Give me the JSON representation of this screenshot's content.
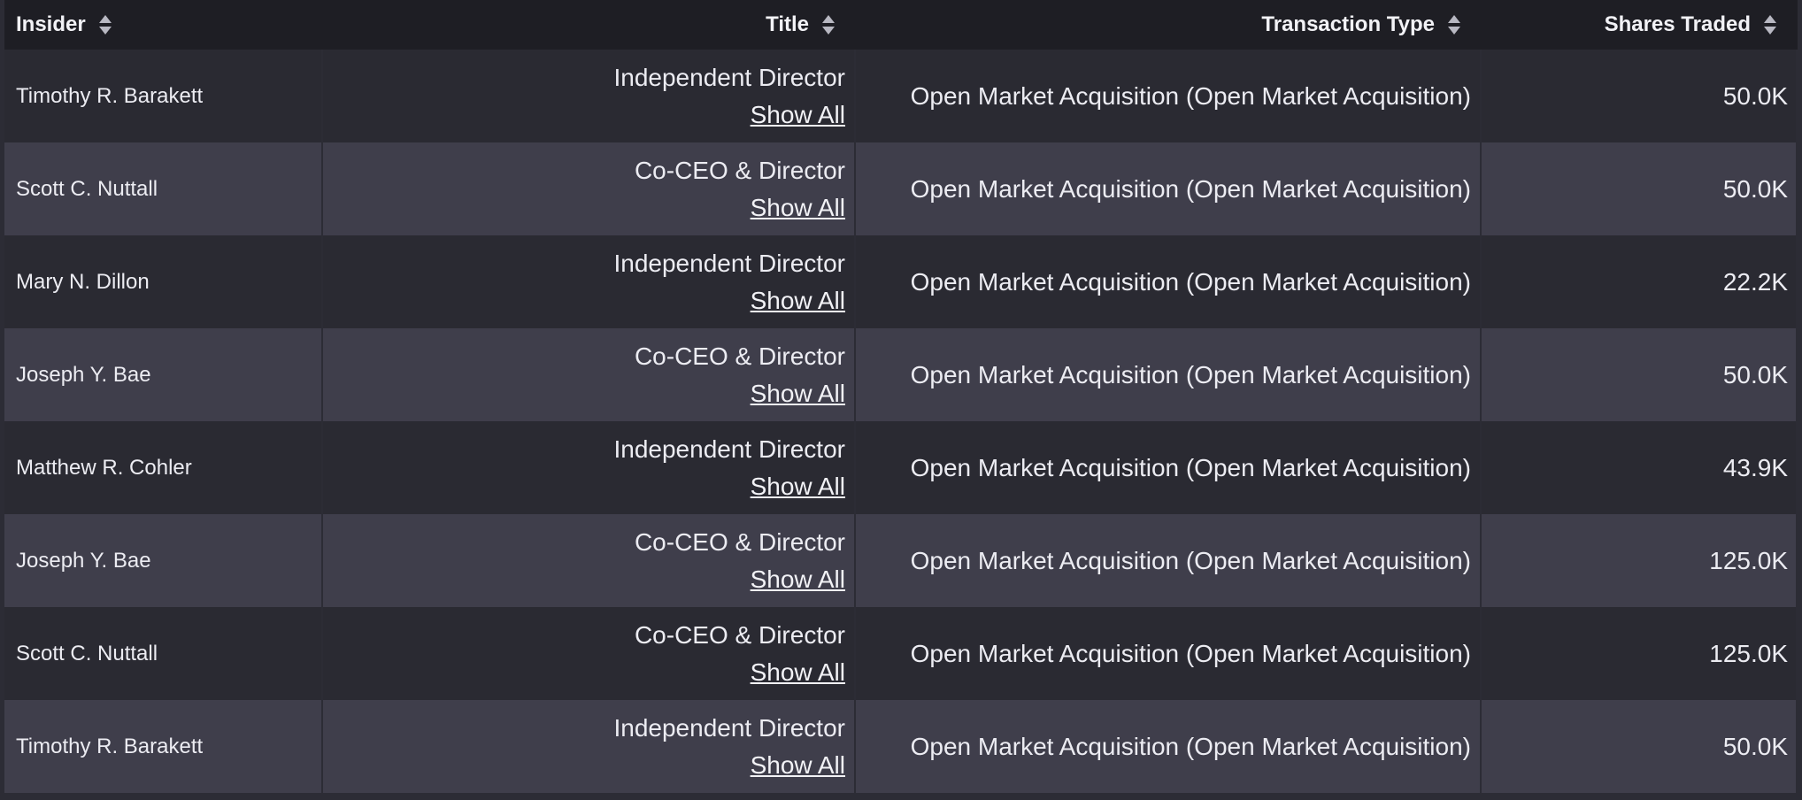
{
  "table": {
    "columns": [
      {
        "label": "Insider",
        "align": "left"
      },
      {
        "label": "Title",
        "align": "right"
      },
      {
        "label": "Transaction Type",
        "align": "right"
      },
      {
        "label": "Shares Traded",
        "align": "right"
      }
    ],
    "show_all_label": "Show All",
    "rows": [
      {
        "insider": "Timothy R. Barakett",
        "title": "Independent Director",
        "show_all": "Show All",
        "type": "Open Market Acquisition (Open Market Acquisition)",
        "shares": "50.0K"
      },
      {
        "insider": "Scott C. Nuttall",
        "title": "Co-CEO & Director",
        "show_all": "Show All",
        "type": "Open Market Acquisition (Open Market Acquisition)",
        "shares": "50.0K"
      },
      {
        "insider": "Mary N. Dillon",
        "title": "Independent Director",
        "show_all": "Show All",
        "type": "Open Market Acquisition (Open Market Acquisition)",
        "shares": "22.2K"
      },
      {
        "insider": "Joseph Y. Bae",
        "title": "Co-CEO & Director",
        "show_all": "Show All",
        "type": "Open Market Acquisition (Open Market Acquisition)",
        "shares": "50.0K"
      },
      {
        "insider": "Matthew R. Cohler",
        "title": "Independent Director",
        "show_all": "Show All",
        "type": "Open Market Acquisition (Open Market Acquisition)",
        "shares": "43.9K"
      },
      {
        "insider": "Joseph Y. Bae",
        "title": "Co-CEO & Director",
        "show_all": "Show All",
        "type": "Open Market Acquisition (Open Market Acquisition)",
        "shares": "125.0K"
      },
      {
        "insider": "Scott C. Nuttall",
        "title": "Co-CEO & Director",
        "show_all": "Show All",
        "type": "Open Market Acquisition (Open Market Acquisition)",
        "shares": "125.0K"
      },
      {
        "insider": "Timothy R. Barakett",
        "title": "Independent Director",
        "show_all": "Show All",
        "type": "Open Market Acquisition (Open Market Acquisition)",
        "shares": "50.0K"
      }
    ]
  },
  "colors": {
    "header_bg": "#1e1e24",
    "row_odd_bg": "#2a2a32",
    "row_even_bg": "#3f3e4b",
    "text": "#ececf2"
  }
}
